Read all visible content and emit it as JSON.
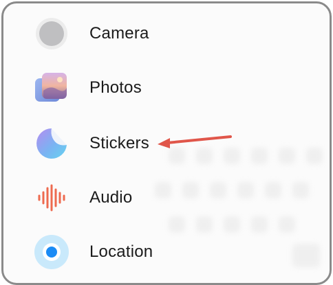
{
  "menu": {
    "items": [
      {
        "label": "Camera",
        "icon": "camera-icon"
      },
      {
        "label": "Photos",
        "icon": "photos-icon"
      },
      {
        "label": "Stickers",
        "icon": "stickers-icon"
      },
      {
        "label": "Audio",
        "icon": "audio-waveform-icon"
      },
      {
        "label": "Location",
        "icon": "location-icon"
      }
    ]
  },
  "annotation": {
    "arrow_color": "#e0564a",
    "target": "Stickers"
  },
  "colors": {
    "frame_border": "#8a8a8a",
    "location_blue": "#1a8bf5",
    "audio_red": "#ee6a4f"
  }
}
